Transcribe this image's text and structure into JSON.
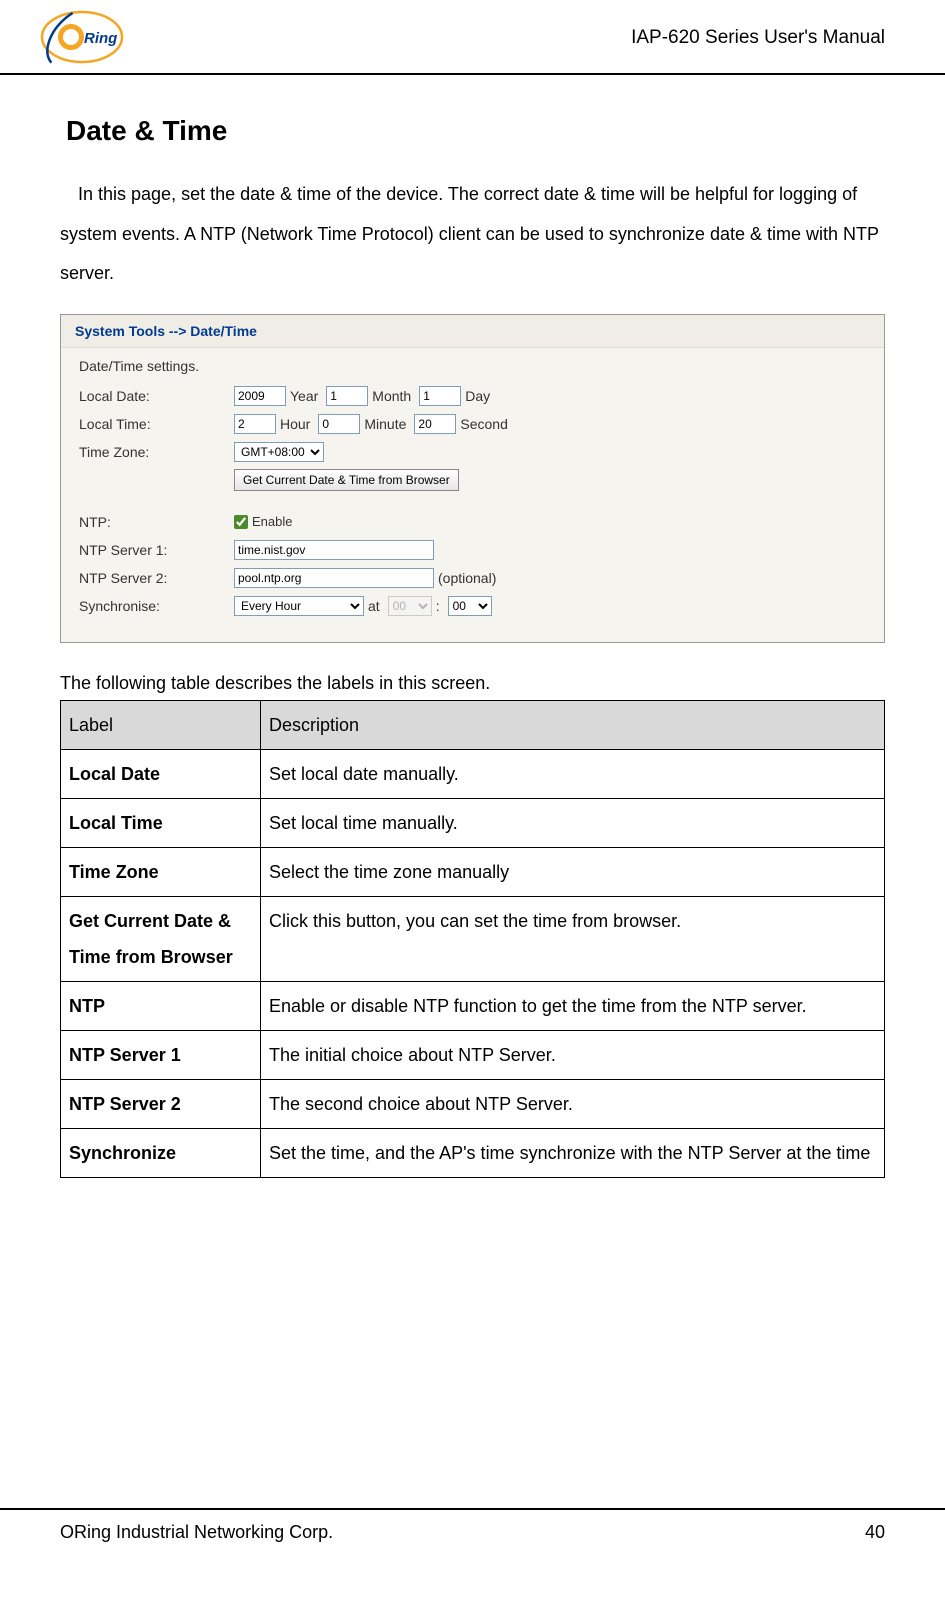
{
  "header": {
    "title": "IAP-620 Series User's Manual"
  },
  "section": {
    "title": "Date & Time",
    "intro": "In this page, set the date & time of the device.   The correct date & time will be helpful for logging of system events.   A NTP (Network Time Protocol) client can be used to synchronize date & time with NTP server."
  },
  "screenshot": {
    "breadcrumb": "System Tools --> Date/Time",
    "section_label": "Date/Time settings.",
    "local_date_label": "Local Date:",
    "year_value": "2009",
    "year_label": "Year",
    "month_value": "1",
    "month_label": "Month",
    "day_value": "1",
    "day_label": "Day",
    "local_time_label": "Local Time:",
    "hour_value": "2",
    "hour_label": "Hour",
    "minute_value": "0",
    "minute_label": "Minute",
    "second_value": "20",
    "second_label": "Second",
    "timezone_label": "Time Zone:",
    "timezone_value": "GMT+08:00",
    "get_browser_button": "Get Current Date & Time from Browser",
    "ntp_label": "NTP:",
    "ntp_enable_label": "Enable",
    "ntp1_label": "NTP Server 1:",
    "ntp1_value": "time.nist.gov",
    "ntp2_label": "NTP Server 2:",
    "ntp2_value": "pool.ntp.org",
    "ntp2_optional": "(optional)",
    "sync_label": "Synchronise:",
    "sync_value": "Every Hour",
    "sync_at": "at",
    "sync_hh": "00",
    "sync_colon": ":",
    "sync_mm": "00"
  },
  "table_intro": "The following table describes the labels in this screen.",
  "table": {
    "header_label": "Label",
    "header_desc": "Description",
    "rows": [
      {
        "label": "Local Date",
        "desc": "Set local date manually."
      },
      {
        "label": "Local Time",
        "desc": "Set local time manually."
      },
      {
        "label": "Time Zone",
        "desc": "Select the time zone manually"
      },
      {
        "label": "Get Current Date & Time from Browser",
        "desc": "Click this button, you can set the time from browser."
      },
      {
        "label": "NTP",
        "desc": "Enable or disable NTP function to get the time from the NTP server."
      },
      {
        "label": "NTP Server 1",
        "desc": "The initial choice about NTP Server."
      },
      {
        "label": "NTP Server 2",
        "desc": "The second choice about NTP Server."
      },
      {
        "label": "Synchronize",
        "desc": "Set the time, and the AP's time synchronize with the NTP Server at the time"
      }
    ]
  },
  "footer": {
    "company": "ORing Industrial Networking Corp.",
    "page": "40"
  }
}
